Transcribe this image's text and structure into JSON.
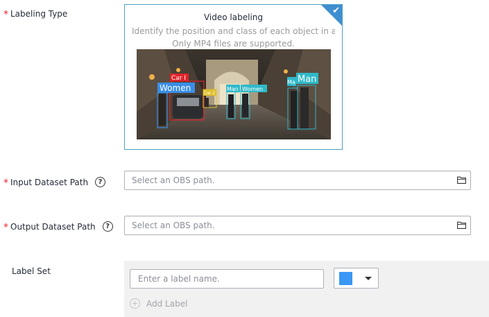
{
  "labeling_type": {
    "label": "Labeling Type",
    "card": {
      "title": "Video labeling",
      "description": "Identify the position and class of each object in a vi...",
      "note": "Only MP4 files are supported.",
      "selected": true,
      "preview_tags": [
        "Car I",
        "Women",
        "Car 2",
        "Man",
        "Women",
        "Ma",
        "Man"
      ],
      "colors": {
        "accent": "#3f8fd0",
        "red_box": "#e0242b",
        "blue_box": "#3a8ee6",
        "cyan_box": "#2fb9c9",
        "yellow_box": "#e0c02b"
      }
    }
  },
  "input_dataset": {
    "label": "Input Dataset Path",
    "placeholder": "Select an OBS path.",
    "help_glyph": "?",
    "icon": "folder-icon"
  },
  "output_dataset": {
    "label": "Output Dataset Path",
    "placeholder": "Select an OBS path.",
    "help_glyph": "?",
    "icon": "folder-icon"
  },
  "label_set": {
    "label": "Label Set",
    "name_placeholder": "Enter a label name.",
    "selected_color": "#3a97f5",
    "add_label": "Add Label"
  },
  "required_mark": "*"
}
